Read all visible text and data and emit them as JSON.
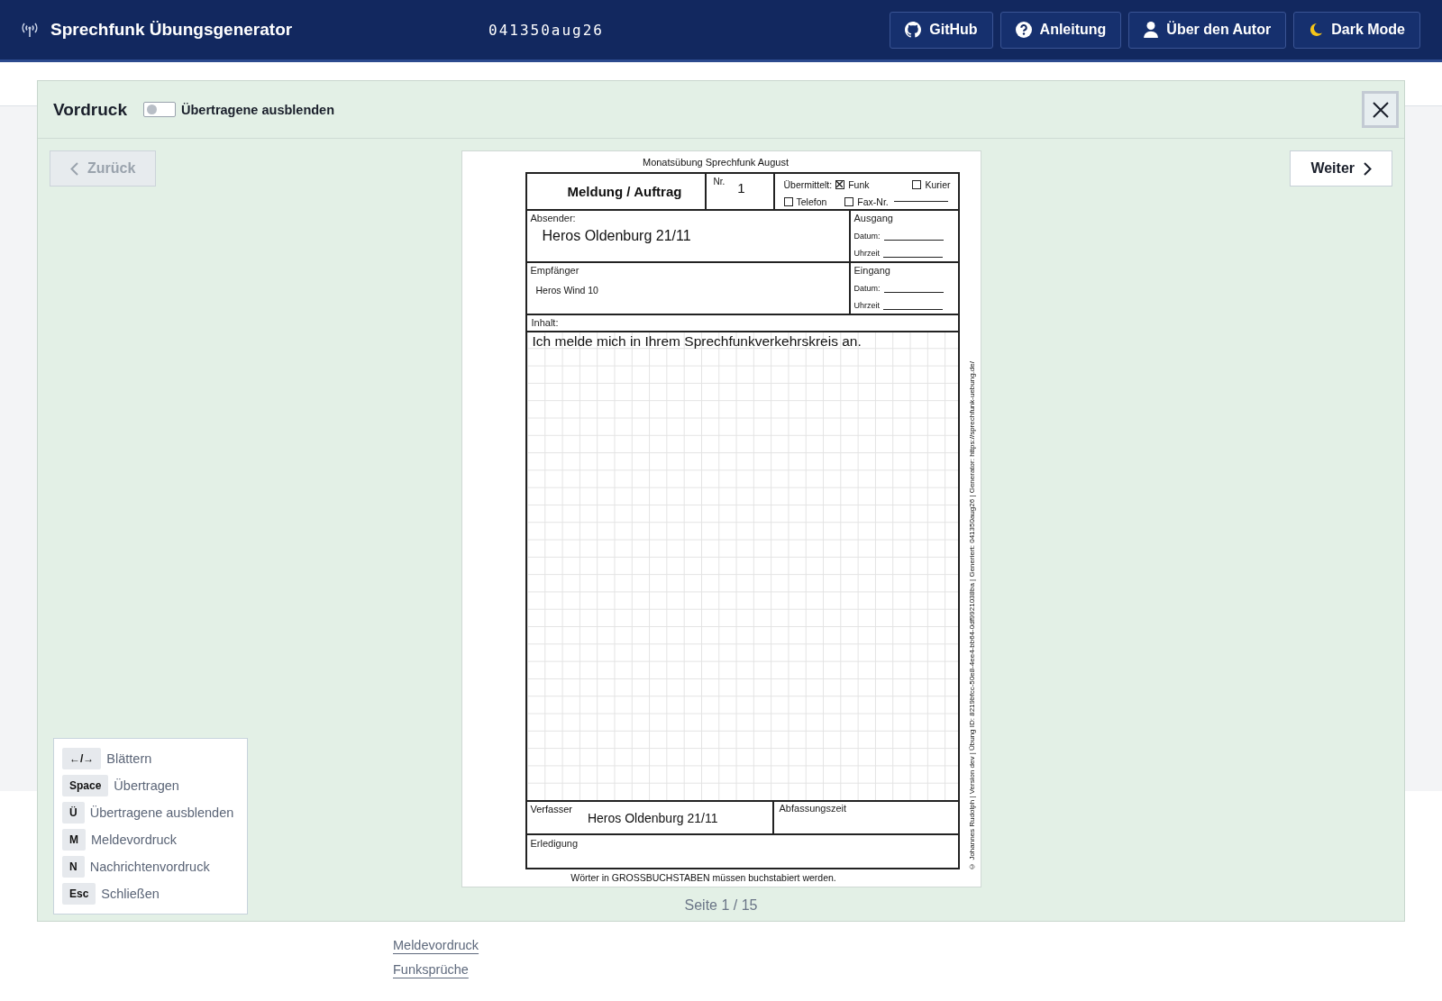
{
  "header": {
    "title": "Sprechfunk Übungsgenerator",
    "code": "041350aug26",
    "buttons": [
      {
        "kind": "github",
        "label": "GitHub"
      },
      {
        "kind": "help",
        "label": "Anleitung"
      },
      {
        "kind": "person",
        "label": "Über den Autor"
      },
      {
        "kind": "moon",
        "label": "Dark Mode"
      }
    ]
  },
  "modal": {
    "title": "Vordruck",
    "toggle": {
      "label": "Übertragene ausblenden",
      "on": false
    },
    "back": {
      "label": "Zurück",
      "disabled": true
    },
    "next": {
      "label": "Weiter",
      "disabled": false
    },
    "page": "Seite 1 / 15",
    "shortcuts": [
      {
        "key": "←/→",
        "label": "Blättern"
      },
      {
        "key": "Space",
        "label": "Übertragen"
      },
      {
        "key": "Ü",
        "label": "Übertragene ausblenden"
      },
      {
        "key": "M",
        "label": "Meldevordruck"
      },
      {
        "key": "N",
        "label": "Nachrichtenvordruck"
      },
      {
        "key": "Esc",
        "label": "Schließen"
      }
    ]
  },
  "sheet": {
    "heading": "Monatsübung Sprechfunk August",
    "form_title": "Meldung / Auftrag",
    "nr_label": "Nr.",
    "nr": "1",
    "transmitted_label": "Übermittelt:",
    "channels": [
      {
        "label": "Funk",
        "checked": true
      },
      {
        "label": "Kurier",
        "checked": false
      },
      {
        "label": "Telefon",
        "checked": false
      },
      {
        "label": "Fax-Nr.",
        "checked": false
      }
    ],
    "sender_label": "Absender:",
    "sender": "Heros Oldenburg 21/11",
    "outgoing": {
      "label": "Ausgang",
      "date_label": "Datum:",
      "time_label": "Uhrzeit"
    },
    "recipient_label": "Empfänger",
    "recipient": "Heros Wind 10",
    "incoming": {
      "label": "Eingang",
      "date_label": "Datum:",
      "time_label": "Uhrzeit"
    },
    "content_label": "Inhalt:",
    "content": "Ich melde mich in Ihrem Sprechfunkverkehrskreis an.",
    "author_label": "Verfasser",
    "author": "Heros Oldenburg 21/11",
    "drafting_time_label": "Abfassungszeit",
    "completion_label": "Erledigung",
    "note": "Wörter in GROSSBUCHSTABEN müssen buchstabiert werden.",
    "side_note": "© Johannes Rudolph | Version dev | Übung ID: 8219bfcc-50e8-4ee4-bb64-0df9921038ba | Generiert: 041350aug26 | Generator: https://sprechfunk-uebung.de/"
  },
  "footer_links": [
    "Meldevordruck",
    "Funksprüche"
  ]
}
